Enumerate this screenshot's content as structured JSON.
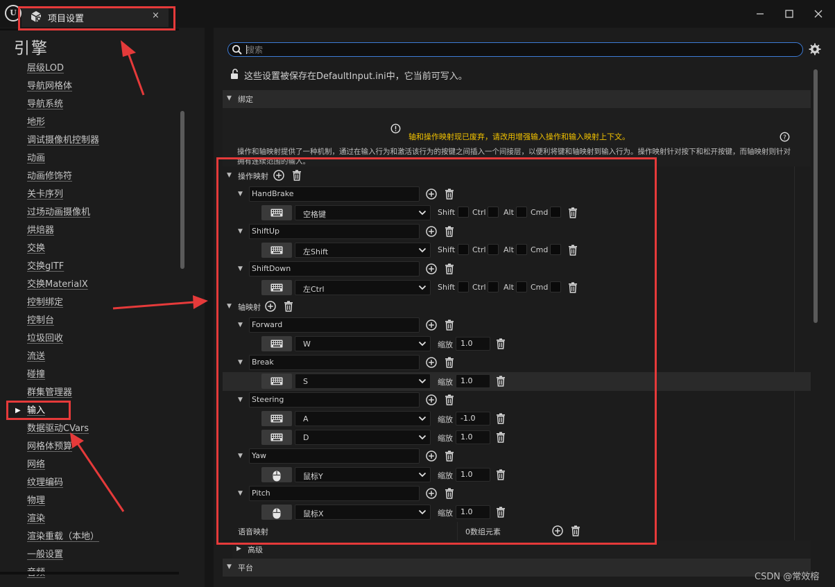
{
  "window": {
    "logo_text": "U",
    "tab_title": "项目设置",
    "tab_close": "×"
  },
  "sidebar": {
    "heading": "引擎",
    "items": [
      {
        "label": "层级LOD"
      },
      {
        "label": "导航网格体"
      },
      {
        "label": "导航系统"
      },
      {
        "label": "地形"
      },
      {
        "label": "调试摄像机控制器"
      },
      {
        "label": "动画"
      },
      {
        "label": "动画修饰符"
      },
      {
        "label": "关卡序列"
      },
      {
        "label": "过场动画摄像机"
      },
      {
        "label": "烘焙器"
      },
      {
        "label": "交换"
      },
      {
        "label": "交换glTF"
      },
      {
        "label": "交换MaterialX"
      },
      {
        "label": "控制绑定"
      },
      {
        "label": "控制台"
      },
      {
        "label": "垃圾回收"
      },
      {
        "label": "流送"
      },
      {
        "label": "碰撞"
      },
      {
        "label": "群集管理器"
      },
      {
        "label": "输入",
        "active": true
      },
      {
        "label": "数据驱动CVars"
      },
      {
        "label": "网格体预算"
      },
      {
        "label": "网络"
      },
      {
        "label": "纹理编码"
      },
      {
        "label": "物理"
      },
      {
        "label": "渲染"
      },
      {
        "label": "渲染重载（本地）"
      },
      {
        "label": "一般设置"
      },
      {
        "label": "音频"
      }
    ]
  },
  "search": {
    "placeholder": "搜索",
    "value": ""
  },
  "notice": "这些设置被保存在DefaultInput.ini中，它当前可写入。",
  "bindings": {
    "section_label": "绑定",
    "warning": "轴和操作映射现已废弃，请改用增强输入操作和输入映射上下文。",
    "description": "操作和轴映射提供了一种机制，通过在输入行为和激活该行为的按键之间插入一个间接层，以便利将键和轴映射到输入行为。操作映射针对按下和松开按键，而轴映射则针对拥有连续范围的输入。",
    "action_label": "操作映射",
    "modifiers": [
      "Shift",
      "Ctrl",
      "Alt",
      "Cmd"
    ],
    "actions": [
      {
        "name": "HandBrake",
        "key": "空格键",
        "device": "keyboard"
      },
      {
        "name": "ShiftUp",
        "key": "左Shift",
        "device": "keyboard"
      },
      {
        "name": "ShiftDown",
        "key": "左Ctrl",
        "device": "keyboard"
      }
    ],
    "axis_label": "轴映射",
    "scale_label": "缩放",
    "axes": [
      {
        "name": "Forward",
        "keys": [
          {
            "key": "W",
            "scale": "1.0",
            "device": "keyboard"
          }
        ]
      },
      {
        "name": "Break",
        "keys": [
          {
            "key": "S",
            "scale": "1.0",
            "device": "keyboard"
          }
        ]
      },
      {
        "name": "Steering",
        "keys": [
          {
            "key": "A",
            "scale": "-1.0",
            "device": "keyboard"
          },
          {
            "key": "D",
            "scale": "1.0",
            "device": "keyboard"
          }
        ]
      },
      {
        "name": "Yaw",
        "keys": [
          {
            "key": "鼠标Y",
            "scale": "1.0",
            "device": "mouse"
          }
        ]
      },
      {
        "name": "Pitch",
        "keys": [
          {
            "key": "鼠标X",
            "scale": "1.0",
            "device": "mouse"
          }
        ]
      }
    ],
    "voice_label": "语音映射",
    "voice_count": "0数组元素"
  },
  "advanced_label": "高级",
  "platform_label": "平台",
  "watermark": "CSDN @常效榕",
  "colors": {
    "annotation_red": "#e53a3a",
    "warning_yellow": "#f2c200",
    "search_border": "#3d7bd5"
  }
}
